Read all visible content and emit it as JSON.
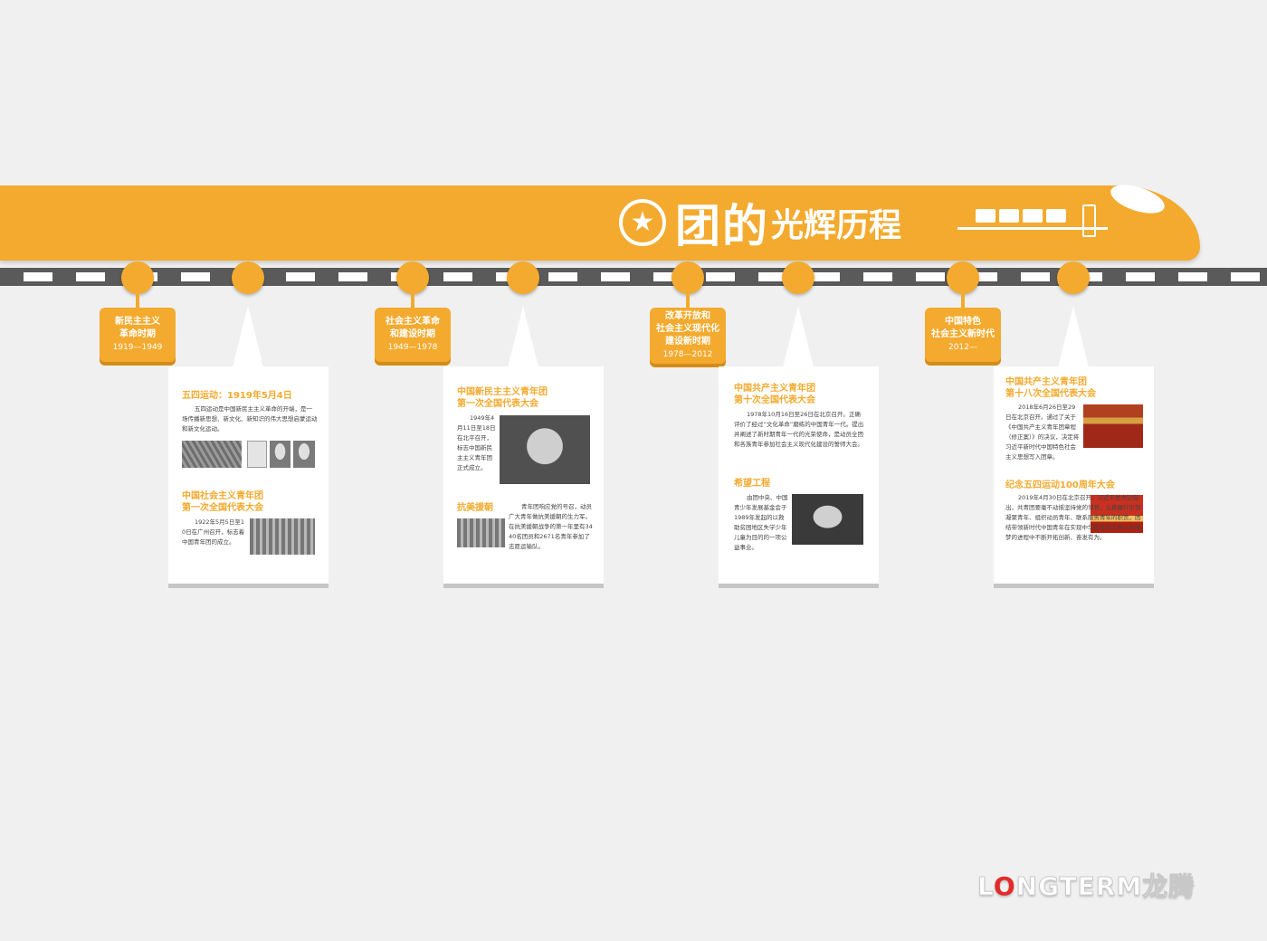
{
  "banner": {
    "title_big": "团的",
    "title_small": "光辉历程"
  },
  "periods": [
    {
      "line1": "新民主主义",
      "line2": "革命时期",
      "line3": "",
      "years": "1919—1949"
    },
    {
      "line1": "社会主义革命",
      "line2": "和建设时期",
      "line3": "",
      "years": "1949—1978"
    },
    {
      "line1": "改革开放和",
      "line2": "社会主义现代化",
      "line3": "建设新时期",
      "years": "1978—2012"
    },
    {
      "line1": "中国特色",
      "line2": "社会主义新时代",
      "line3": "",
      "years": "2012—"
    }
  ],
  "cards": [
    {
      "s1_title": "五四运动：1919年5月4日",
      "s1_text": "五四运动是中国新民主主义革命的开端，是一场传播新思想、新文化、新知识的伟大思想启蒙运动和新文化运动。",
      "s2_title_l1": "中国社会主义青年团",
      "s2_title_l2": "第一次全国代表大会",
      "s2_text": "1922年5月5日至10日在广州召开，标志着中国青年团的成立。"
    },
    {
      "s1_title_l1": "中国新民主主义青年团",
      "s1_title_l2": "第一次全国代表大会",
      "s1_text": "1949年4月11日至18日在北平召开，标志中国新民主主义青年团正式成立。",
      "s2_title": "抗美援朝",
      "s2_text": "青年团响应党的号召，动员广大青年做抗美援朝的生力军。在抗美援朝战争的第一年里有3440名团员和2671名青年参加了志愿运输队。"
    },
    {
      "s1_title_l1": "中国共产主义青年团",
      "s1_title_l2": "第十次全国代表大会",
      "s1_text": "1978年10月16日至26日在北京召开。正确评价了经过“文化革命”磨练的中国青年一代。提出并阐述了新时期青年一代的光荣使命，是动员全团和各族青年参加社会主义现代化建设的誓师大会。",
      "s2_title": "希望工程",
      "s2_text": "由团中央、中国青少年发展基金会于1989年发起的以救助贫困地区失学少年儿童为目的的一项公益事业。"
    },
    {
      "s1_title_l1": "中国共产主义青年团",
      "s1_title_l2": "第十八次全国代表大会",
      "s1_text": "2018年6月26日至29日在北京召开。通过了关于《中国共产主义青年团章程（修正案）》的决议，决定将习近平新时代中国特色社会主义思想写入团章。",
      "s2_title": "纪念五四运动100周年大会",
      "s2_text": "2019年4月30日在北京召开。习近平总书记指出，共青团要毫不动摇坚持党的领导，认真履行引领凝聚青年、组织动员青年、联系服务青年的职责，团结带领新时代中国青年在实现中华民族伟大复兴中国梦的进程中不断开拓创新、奋发有为。"
    }
  ],
  "brand": {
    "logo_l": "L",
    "logo_o": "O",
    "logo_rest": "NGTERM龙腾"
  },
  "colors": {
    "accent": "#f3aa2e",
    "track": "#5a5a5a",
    "background": "#f0f0f0"
  }
}
